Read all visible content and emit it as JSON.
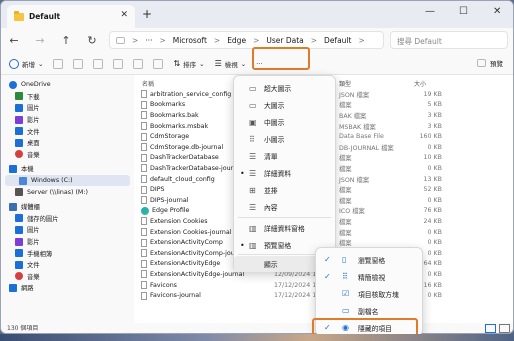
{
  "window": {
    "tab_title": "Default",
    "tab_close": "✕",
    "new_tab": "+",
    "minimize": "—",
    "maximize": "☐",
    "close": "✕"
  },
  "nav": {
    "back": "←",
    "forward": "→",
    "up": "↑",
    "refresh": "↻",
    "breadcrumb": [
      "Microsoft",
      "Edge",
      "User Data",
      "Default"
    ],
    "more": "···",
    "sep": ">",
    "search_placeholder": "搜尋 Default"
  },
  "toolbar": {
    "new": "新增",
    "new_arrow": "⌄",
    "sort": "排序",
    "sort_arrow": "⌄",
    "view": "檢視",
    "view_arrow": "⌄",
    "more": "···",
    "preview": "預覽"
  },
  "sidebar": {
    "items": [
      {
        "label": "OneDrive",
        "color": "#1b6fd6"
      },
      {
        "label": "下載",
        "color": "#2b8a3e"
      },
      {
        "label": "圖片",
        "color": "#1b6fd6"
      },
      {
        "label": "影片",
        "color": "#7b3fd6"
      },
      {
        "label": "文件",
        "color": "#1b6fd6"
      },
      {
        "label": "桌面",
        "color": "#1b6fd6"
      },
      {
        "label": "音樂",
        "color": "#d63f3f"
      },
      {
        "label": "本機",
        "color": "#1b6fd6"
      },
      {
        "label": "Windows (C:)",
        "color": "#4a88d6"
      },
      {
        "label": "Server (\\\\linas) (M:)",
        "color": "#555555"
      },
      {
        "label": "媒體櫃",
        "color": "#3a70b0"
      },
      {
        "label": "儲存的圖片",
        "color": "#1b6fd6"
      },
      {
        "label": "圖片",
        "color": "#1b6fd6"
      },
      {
        "label": "影片",
        "color": "#7b3fd6"
      },
      {
        "label": "手機相簿",
        "color": "#1b6fd6"
      },
      {
        "label": "文件",
        "color": "#1b6fd6"
      },
      {
        "label": "音樂",
        "color": "#d63f3f"
      },
      {
        "label": "網路",
        "color": "#1b6fd6"
      }
    ]
  },
  "columns": {
    "name": "名稱",
    "type": "類型",
    "size": "大小"
  },
  "files": [
    {
      "name": "arbitration_service_config",
      "date": "42",
      "type": "JSON 檔案",
      "size": "19 KB"
    },
    {
      "name": "Bookmarks",
      "date": "32",
      "type": "檔案",
      "size": "5 KB"
    },
    {
      "name": "Bookmarks.bak",
      "date": "05",
      "type": "BAK 檔案",
      "size": "3 KB"
    },
    {
      "name": "Bookmarks.msbak",
      "date": "05",
      "type": "MSBAK 檔案",
      "size": "3 KB"
    },
    {
      "name": "CdmStorage",
      "date": "05",
      "type": "Data Base File",
      "size": "160 KB"
    },
    {
      "name": "CdmStorage.db-journal",
      "date": "05",
      "type": "DB-JOURNAL 檔案",
      "size": "0 KB"
    },
    {
      "name": "DashTrackerDatabase",
      "date": "08",
      "type": "檔案",
      "size": "10 KB"
    },
    {
      "name": "DashTrackerDatabase-journal",
      "date": "08",
      "type": "檔案",
      "size": "0 KB"
    },
    {
      "name": "default_cloud_config",
      "date": "15",
      "type": "JSON 檔案",
      "size": "13 KB"
    },
    {
      "name": "DIPS",
      "date": "15",
      "type": "檔案",
      "size": "52 KB"
    },
    {
      "name": "DIPS-journal",
      "date": "15",
      "type": "檔案",
      "size": "0 KB"
    },
    {
      "name": "Edge Profile",
      "date": "17",
      "type": "ICO 檔案",
      "size": "76 KB"
    },
    {
      "name": "Extension Cookies",
      "date": "15",
      "type": "檔案",
      "size": "24 KB"
    },
    {
      "name": "Extension Cookies-journal",
      "date": "15",
      "type": "檔案",
      "size": "0 KB"
    },
    {
      "name": "ExtensionActivityComp",
      "date": "08",
      "type": "檔案",
      "size": "0 KB"
    },
    {
      "name": "ExtensionActivityComp-journal",
      "date": "08",
      "type": "檔案",
      "size": "0 KB"
    },
    {
      "name": "ExtensionActivityEdge",
      "date": "12/09/2024 13:08",
      "type": "檔案",
      "size": "64 KB"
    },
    {
      "name": "ExtensionActivityEdge-journal",
      "date": "12/09/2024 13:08",
      "type": "檔案",
      "size": "0 KB"
    },
    {
      "name": "Favicons",
      "date": "17/12/2024 14:30",
      "type": "檔案",
      "size": "116 KB"
    },
    {
      "name": "Favicons-journal",
      "date": "17/12/2024 14:30",
      "type": "檔案",
      "size": "0 KB"
    }
  ],
  "view_menu": {
    "items": [
      {
        "label": "超大圖示",
        "icon": "▭",
        "checked": ""
      },
      {
        "label": "大圖示",
        "icon": "▭",
        "checked": ""
      },
      {
        "label": "中圖示",
        "icon": "▣",
        "checked": ""
      },
      {
        "label": "小圖示",
        "icon": "⠿",
        "checked": ""
      },
      {
        "label": "清單",
        "icon": "☰",
        "checked": ""
      },
      {
        "label": "詳細資料",
        "icon": "☰",
        "checked": "•"
      },
      {
        "label": "並排",
        "icon": "⊞",
        "checked": ""
      },
      {
        "label": "內容",
        "icon": "☰",
        "checked": ""
      },
      {
        "label": "詳細資料窗格",
        "icon": "▥",
        "checked": ""
      },
      {
        "label": "預覽窗格",
        "icon": "▥",
        "checked": "•"
      }
    ],
    "show_label": "顯示",
    "show_arrow": "›"
  },
  "show_menu": {
    "items": [
      {
        "label": "瀏覽窗格",
        "check": "✓",
        "icon": "▯"
      },
      {
        "label": "精簡檢視",
        "check": "✓",
        "icon": "⠿"
      },
      {
        "label": "項目核取方塊",
        "check": "",
        "icon": "☑"
      },
      {
        "label": "副檔名",
        "check": "",
        "icon": "▭"
      },
      {
        "label": "隱藏的項目",
        "check": "✓",
        "icon": "◉"
      }
    ]
  },
  "status": {
    "count": "130 個項目"
  }
}
